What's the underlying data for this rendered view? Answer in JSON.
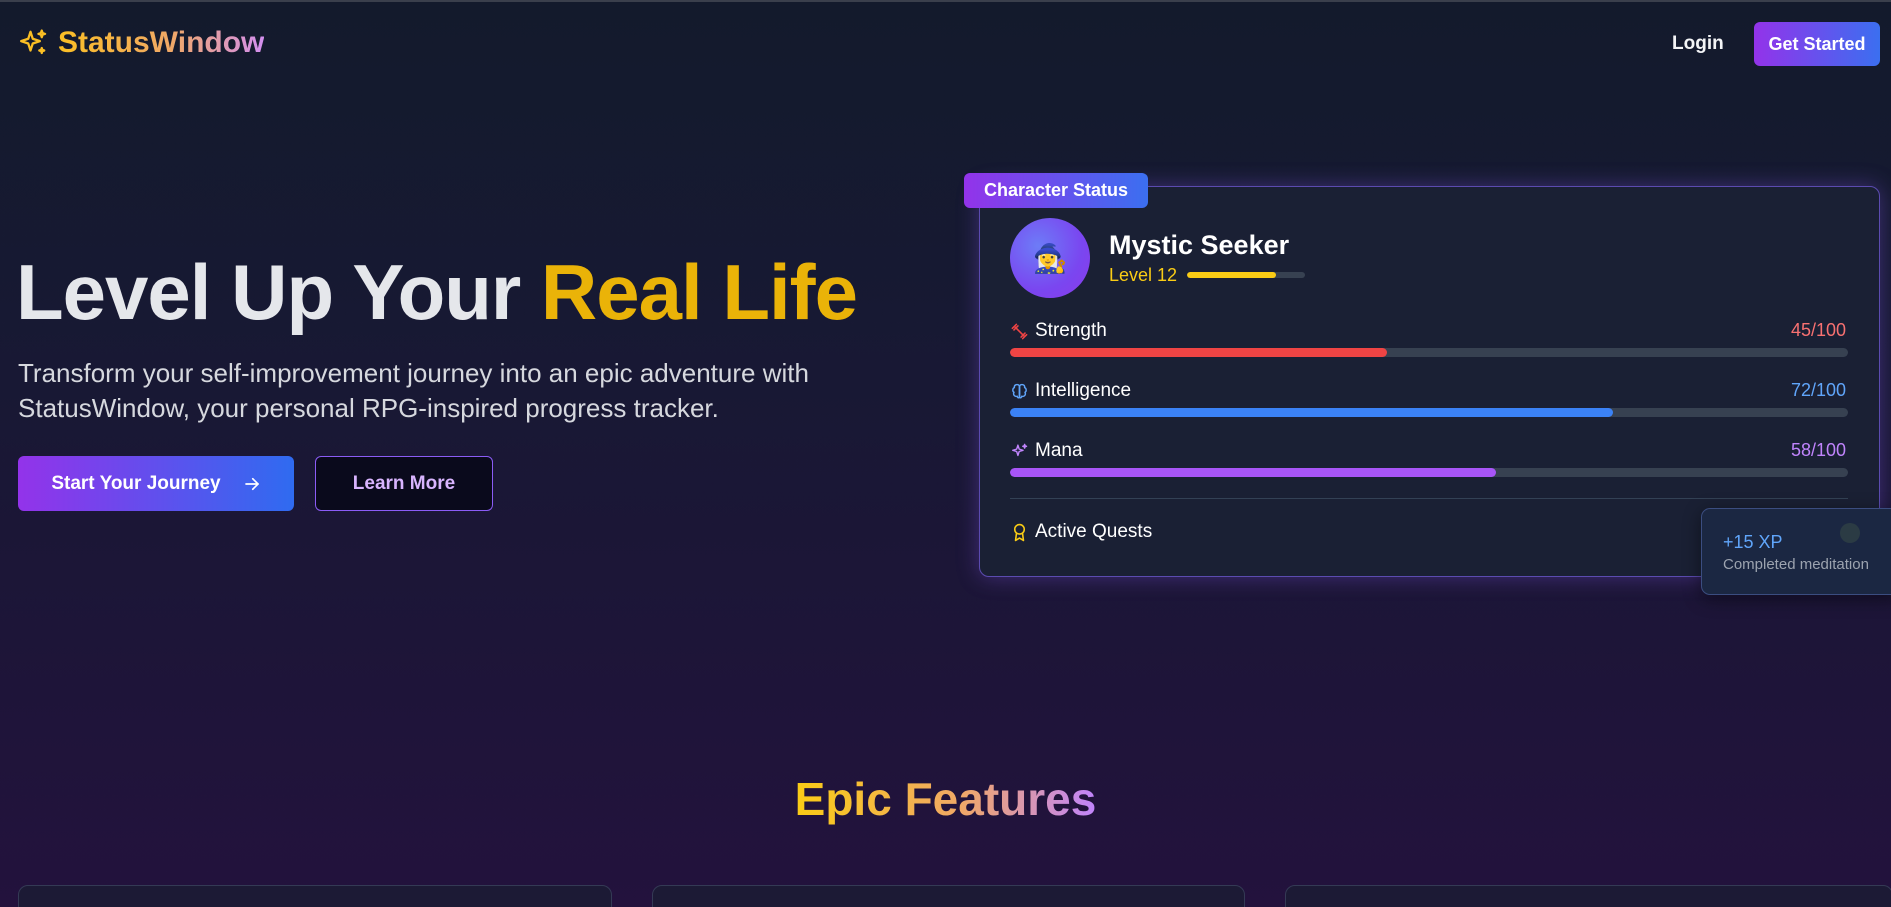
{
  "nav": {
    "brand": "StatusWindow",
    "login": "Login",
    "get_started": "Get Started"
  },
  "hero": {
    "title_prefix": "Level Up Your ",
    "title_highlight": "Real Life",
    "subtitle": "Transform your self-improvement journey into an epic adventure with StatusWindow, your personal RPG-inspired progress tracker.",
    "primary_button": "Start Your Journey",
    "secondary_button": "Learn More"
  },
  "status_card": {
    "tag": "Character Status",
    "avatar_emoji": "🧙‍♀️",
    "name": "Mystic Seeker",
    "level": "Level 12",
    "level_progress": 0.75,
    "stats": [
      {
        "label": "Strength",
        "value": "45/100",
        "progress": 0.45,
        "color": "#ef4444",
        "icon": "dumbbell-icon"
      },
      {
        "label": "Intelligence",
        "value": "72/100",
        "progress": 0.72,
        "color": "#3b82f6",
        "icon": "brain-icon"
      },
      {
        "label": "Mana",
        "value": "58/100",
        "progress": 0.58,
        "color": "#a855f7",
        "icon": "sparkles-icon"
      }
    ],
    "active_quests": "Active Quests"
  },
  "toast": {
    "xp": "+15 XP",
    "message": "Completed meditation"
  },
  "features": {
    "title": "Epic Features"
  },
  "colors": {
    "accent_yellow": "#eab308",
    "accent_purple": "#9333ea",
    "accent_blue": "#3b6ff0",
    "background": "#171933"
  }
}
